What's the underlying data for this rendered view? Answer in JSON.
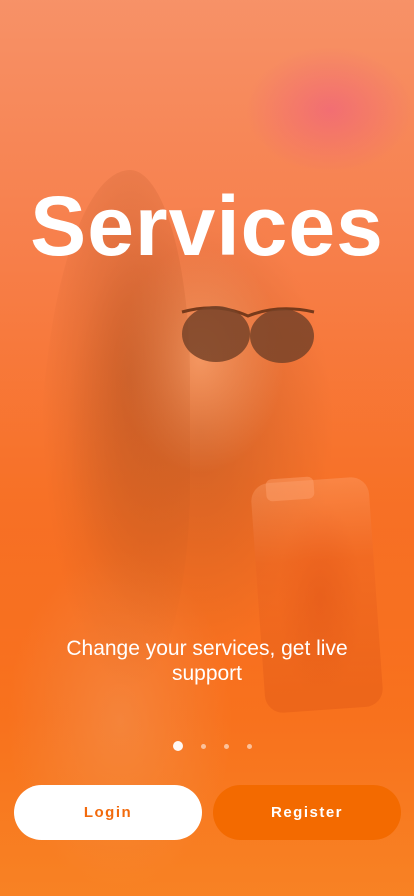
{
  "onboarding": {
    "title": "Services",
    "subtitle": "Change your services, get live support",
    "page_indicator": {
      "total": 4,
      "active_index": 0
    }
  },
  "actions": {
    "login_label": "Login",
    "register_label": "Register"
  },
  "colors": {
    "accent": "#f36a00",
    "login_text": "#f26a0c",
    "text_on_accent": "#ffffff"
  }
}
